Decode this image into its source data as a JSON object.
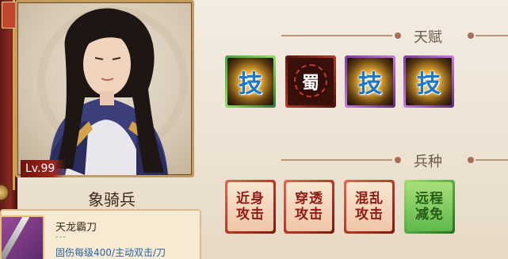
{
  "hero": {
    "level": "Lv.99",
    "unit_type": "象骑兵"
  },
  "skill": {
    "name": "天龙霸刀",
    "separator": "---",
    "description": "固伤每级400/主动双击/刀"
  },
  "talents": {
    "title": "天赋",
    "items": [
      {
        "type": "skill",
        "glyph": "技",
        "frame": "green"
      },
      {
        "type": "faction",
        "glyph": "蜀",
        "frame": "red"
      },
      {
        "type": "skill",
        "glyph": "技",
        "frame": "purple"
      },
      {
        "type": "skill",
        "glyph": "技",
        "frame": "purple"
      }
    ]
  },
  "troops": {
    "title": "兵种",
    "items": [
      {
        "line1": "近身",
        "line2": "攻击",
        "frame": "red"
      },
      {
        "line1": "穿透",
        "line2": "攻击",
        "frame": "red"
      },
      {
        "line1": "混乱",
        "line2": "攻击",
        "frame": "red"
      },
      {
        "line1": "远程",
        "line2": "减免",
        "frame": "green"
      }
    ]
  }
}
